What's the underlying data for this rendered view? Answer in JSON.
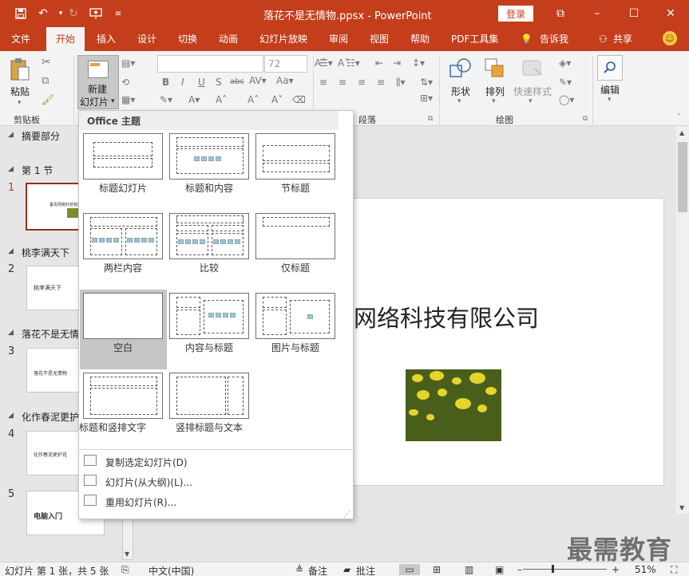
{
  "window": {
    "title": "落花不是无情物.ppsx - PowerPoint",
    "login": "登录",
    "controls": [
      "⧉",
      "–",
      "☐",
      "✕"
    ]
  },
  "qat": [
    "save-icon",
    "undo-icon",
    "redo-icon",
    "present-icon",
    "customize-icon"
  ],
  "menu": {
    "tabs": [
      "文件",
      "开始",
      "插入",
      "设计",
      "切换",
      "动画",
      "幻灯片放映",
      "审阅",
      "视图",
      "帮助",
      "PDF工具集"
    ],
    "tell_me": "告诉我",
    "share": "共享"
  },
  "ribbon": {
    "paste": "粘贴",
    "clipboard": "剪贴板",
    "new_slide_line1": "新建",
    "new_slide_line2": "幻灯片",
    "font_size": "72",
    "paragraph": "段落",
    "shapes": "形状",
    "arrange": "排列",
    "quick_styles": "快速样式",
    "drawing": "绘图",
    "editing": "编辑"
  },
  "gallery": {
    "header": "Office 主题",
    "layouts": [
      {
        "label": "标题幻灯片"
      },
      {
        "label": "标题和内容"
      },
      {
        "label": "节标题"
      },
      {
        "label": "两栏内容"
      },
      {
        "label": "比较"
      },
      {
        "label": "仅标题"
      },
      {
        "label": "空白"
      },
      {
        "label": "内容与标题"
      },
      {
        "label": "图片与标题"
      },
      {
        "label": "标题和竖排文字"
      },
      {
        "label": "竖排标题与文本"
      }
    ],
    "menu_items": [
      "复制选定幻灯片(D)",
      "幻灯片(从大纲)(L)...",
      "重用幻灯片(R)..."
    ]
  },
  "thumbnails": {
    "sections": [
      "摘要部分",
      "第 1 节",
      "桃李满天下",
      "落花不是无情",
      "化作春泥更护"
    ],
    "slides": [
      {
        "num": "1",
        "text": "垂青网络科技有限公司"
      },
      {
        "num": "2",
        "text": "桃李满天下"
      },
      {
        "num": "3",
        "text": "落花不是无情物"
      },
      {
        "num": "4",
        "text": "化作春泥更护花"
      },
      {
        "num": "5",
        "text": "电脑入门"
      }
    ]
  },
  "slide": {
    "title": "网络科技有限公司"
  },
  "status": {
    "slide_info": "幻灯片 第 1 张，共 5 张",
    "language": "中文(中国)",
    "notes": "备注",
    "comments": "批注",
    "zoom": "51%"
  },
  "watermark": "最需教育"
}
